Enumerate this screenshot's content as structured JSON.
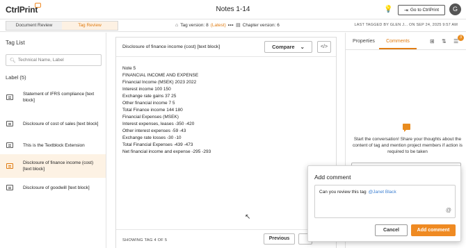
{
  "app": {
    "logo": "CtrlPrint",
    "title": "Notes 1-14",
    "goto_label": "Go to CtrlPrint",
    "avatar_initial": "G"
  },
  "subbar": {
    "tabs": [
      "Document Review",
      "Tag Review"
    ],
    "active_tab": "Tag Review",
    "tag_version_label": "Tag version: 8",
    "tag_version_latest": "(Latest)",
    "chapter_version_label": "Chapter version: 6",
    "last_tagged": "LAST TAGGED BY  GLEN J...  ON SEP 24, 2025 9:57 AM"
  },
  "tag_list": {
    "heading": "Tag List",
    "search_placeholder": "Technical Name, Label",
    "label_heading": "Label (5)",
    "items": [
      {
        "label": "Statement of IFRS compliance [text block]",
        "active": false
      },
      {
        "label": "Disclosure of cost of sales [text block]",
        "active": false
      },
      {
        "label": "This is the Textblock Extension",
        "active": false
      },
      {
        "label": "Disclosure of finance income (cost) [text block]",
        "active": true
      },
      {
        "label": "Disclosure of goodwill [text block]",
        "active": false
      }
    ]
  },
  "content": {
    "title": "Disclosure of finance income (cost) [text block]",
    "compare_label": "Compare",
    "lines": [
      "Note 5",
      "FINANCIAL INCOME AND EXPENSE",
      "Financial Income (MSEK) 2023 2022",
      "Interest income 100 150",
      "Exchange rate gains 37 25",
      "Other financial income 7 5",
      "Total Finance income 144 180",
      "Financial Expenses (MSEK)",
      "Interest expenses, leases -350 -420",
      "Other interest expenses -59 -43",
      "Exchange rate losses -30 -10",
      "Total Financial Expenses -439 -473",
      "Net financial income and expense -295 -293"
    ],
    "showing": "SHOWING TAG 4 OF 5",
    "previous_label": "Previous"
  },
  "right_panel": {
    "tabs": [
      "Properties",
      "Comments"
    ],
    "active_tab": "Comments",
    "filter_badge": "3",
    "empty_message": "Start the conversation! Share your thoughts about the content of tag and mention project members if action is required to be taken"
  },
  "add_comment": {
    "title": "Add comment",
    "text": "Can you review this tag",
    "mention": "@Janet Black",
    "cancel_label": "Cancel",
    "submit_label": "Add comment"
  },
  "colors": {
    "accent": "#e07c12",
    "button_orange": "#ef8a22",
    "mention_blue": "#3c7fd1"
  }
}
